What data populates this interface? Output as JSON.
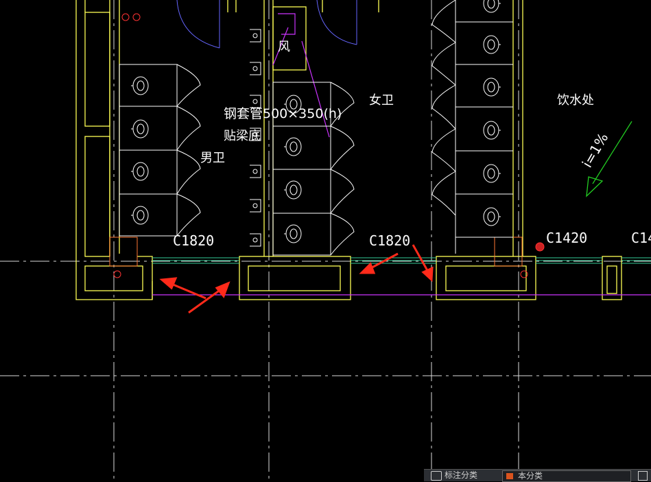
{
  "drawing": {
    "labels": {
      "room_men": "男卫",
      "room_women": "女卫",
      "room_drinking": "饮水处",
      "vent_label": "风",
      "pipe_note_1": "钢套管500×350(h)",
      "pipe_note_2": "贴梁底",
      "slope": "i=1%",
      "window_1": "C1820",
      "window_2": "C1820",
      "window_3": "C1420",
      "window_4": "C14"
    },
    "colors": {
      "wall": "#ffff55",
      "pipe": "#cc33ff",
      "door_arc": "#6666ff",
      "slope_arrow": "#22cc22",
      "axis": "#dddddd",
      "fixture": "#ffffff",
      "annotation_arrow": "#ff2a1a",
      "marker": "#ff3333"
    }
  },
  "statusbar": {
    "layer_label": "标注分类",
    "layer_value": "本分类",
    "layer_icon": "layer-stack-icon",
    "extra_icon": "layer-settings-icon"
  }
}
